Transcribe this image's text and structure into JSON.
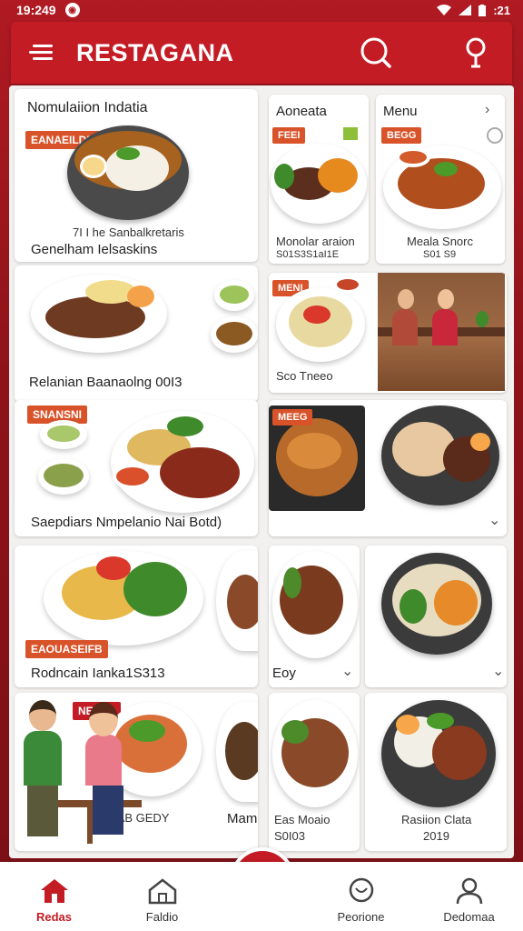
{
  "status": {
    "time": "19:249",
    "right": ":21"
  },
  "appbar": {
    "title": "RESTAGANA"
  },
  "cards": {
    "c1": {
      "title": "Nomulaiion Indatia",
      "tag": "EANAEILDNIN",
      "line1": "7I I he Sanbalkretaris",
      "line2": "Genelham Ielsaskins"
    },
    "c2": {
      "title": "Aoneata",
      "tag": "FEEI",
      "line1": "Monolar araion",
      "line2": "S01S3S1aI1E"
    },
    "c3": {
      "title": "Menu",
      "tag": "BEGG",
      "line1": "Meala Snorc",
      "line2": "S01 S9"
    },
    "c4": {
      "title": "Relanian Baanaolng 00I3"
    },
    "c5": {
      "tag": "MENI",
      "line1": "Sco Tneeo"
    },
    "c6": {
      "tag": "SNANSNI",
      "line1": "Saepdiars Nmpelanio Nai Botd)"
    },
    "c7": {
      "tag": "MEEG"
    },
    "c8": {
      "tag": "EAOUASEIFB",
      "line1": "Rodncain Ianka1S313"
    },
    "c9": {
      "line1": "Eoy"
    },
    "c10": {
      "tag": "NEEED",
      "line1": "AAB GEDY"
    },
    "c11": {
      "line1": "Mamo"
    },
    "c12": {
      "line1": "Eas Moaio",
      "line2": "S0I03"
    },
    "c13": {
      "line1": "Rasiion Clata",
      "line2": "2019"
    }
  },
  "nav": [
    {
      "label": "Redas",
      "icon": "home-icon"
    },
    {
      "label": "Faldio",
      "icon": "house-outline-icon"
    },
    {
      "label": "Peorione",
      "icon": "chat-bubble-icon"
    },
    {
      "label": "Dedomaa",
      "icon": "person-icon"
    }
  ],
  "fab": {
    "icon": "heart-bubble-icon"
  },
  "colors": {
    "brand": "#c41c24",
    "tag": "#d9532a"
  }
}
